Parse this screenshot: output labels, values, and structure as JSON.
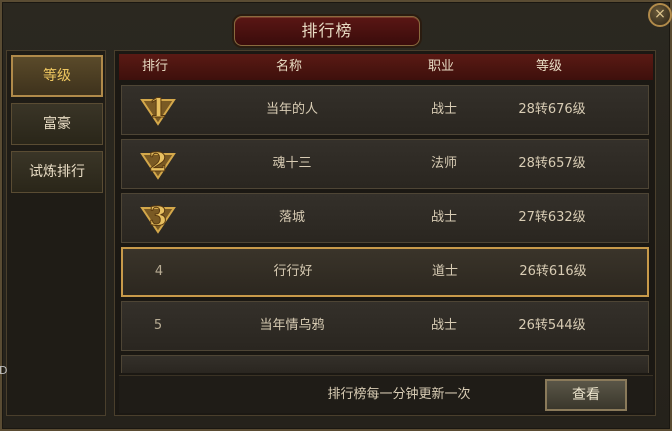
{
  "window": {
    "title": "排行榜",
    "close_icon": "×"
  },
  "sidebar": {
    "items": [
      {
        "label": "等级",
        "active": true
      },
      {
        "label": "富豪",
        "active": false
      },
      {
        "label": "试炼排行",
        "active": false
      }
    ]
  },
  "table": {
    "headers": {
      "rank": "排行",
      "name": "名称",
      "job": "职业",
      "level": "等级"
    },
    "rows": [
      {
        "rank": "1",
        "name": "当年的人",
        "job": "战士",
        "level": "28转676级"
      },
      {
        "rank": "2",
        "name": "魂十三",
        "job": "法师",
        "level": "28转657级"
      },
      {
        "rank": "3",
        "name": "落城",
        "job": "战士",
        "level": "27转632级"
      },
      {
        "rank": "4",
        "name": "行行好",
        "job": "道士",
        "level": "26转616级"
      },
      {
        "rank": "5",
        "name": "当年情乌鸦",
        "job": "战士",
        "level": "26转544级"
      }
    ],
    "selected_row": 4
  },
  "footer": {
    "note": "排行榜每一分钟更新一次",
    "view_label": "查看"
  },
  "edge_text": "D",
  "colors": {
    "accent": "#c89a4a",
    "title_bg": "#4a1210",
    "medal_gold": "#d4a84a"
  }
}
